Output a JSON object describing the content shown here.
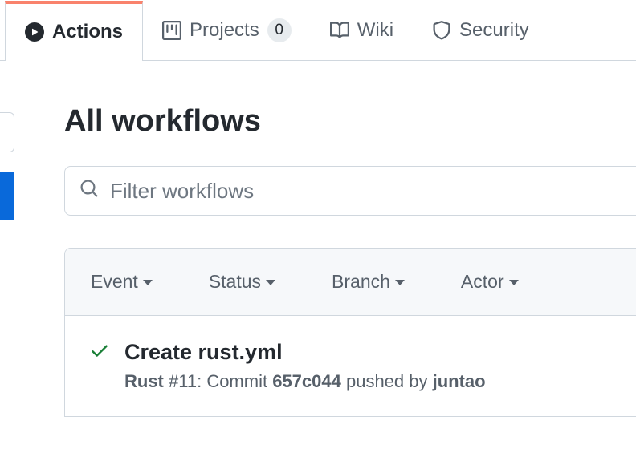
{
  "tabs": {
    "actions": "Actions",
    "projects": "Projects",
    "projects_count": "0",
    "wiki": "Wiki",
    "security": "Security"
  },
  "page": {
    "title": "All workflows"
  },
  "filter": {
    "placeholder": "Filter workflows"
  },
  "listHeader": {
    "event": "Event",
    "status": "Status",
    "branch": "Branch",
    "actor": "Actor"
  },
  "run": {
    "title": "Create rust.yml",
    "workflow": "Rust",
    "run_number_prefix": " #11: ",
    "meta_prefix": "Commit ",
    "commit": "657c044",
    "meta_mid": " pushed by ",
    "author": "juntao"
  }
}
